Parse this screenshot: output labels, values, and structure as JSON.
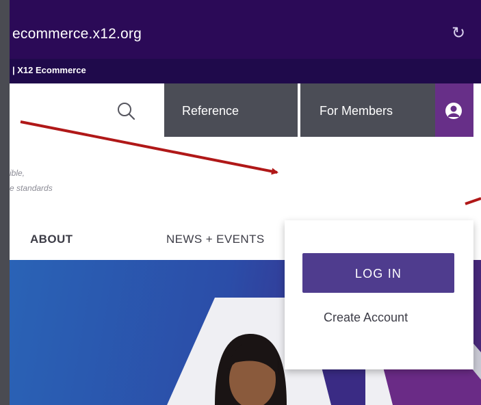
{
  "browser": {
    "url": "ecommerce.x12.org",
    "tab_title": "| X12 Ecommerce"
  },
  "header": {
    "nav_reference": "Reference",
    "nav_members": "For Members",
    "tagline_line1": "ible,",
    "tagline_line2": "e standards"
  },
  "menu": {
    "about": "ABOUT",
    "news_events": "NEWS + EVENTS"
  },
  "dropdown": {
    "login": "LOG IN",
    "create_account": "Create Account"
  },
  "colors": {
    "urlbar": "#2b0a57",
    "nav_gray": "#4b4d56",
    "user_purple": "#672f88",
    "login_button": "#4f3c8e",
    "annotation_arrow": "#b01818"
  },
  "icons": [
    "reload-icon",
    "search-icon",
    "user-icon"
  ]
}
